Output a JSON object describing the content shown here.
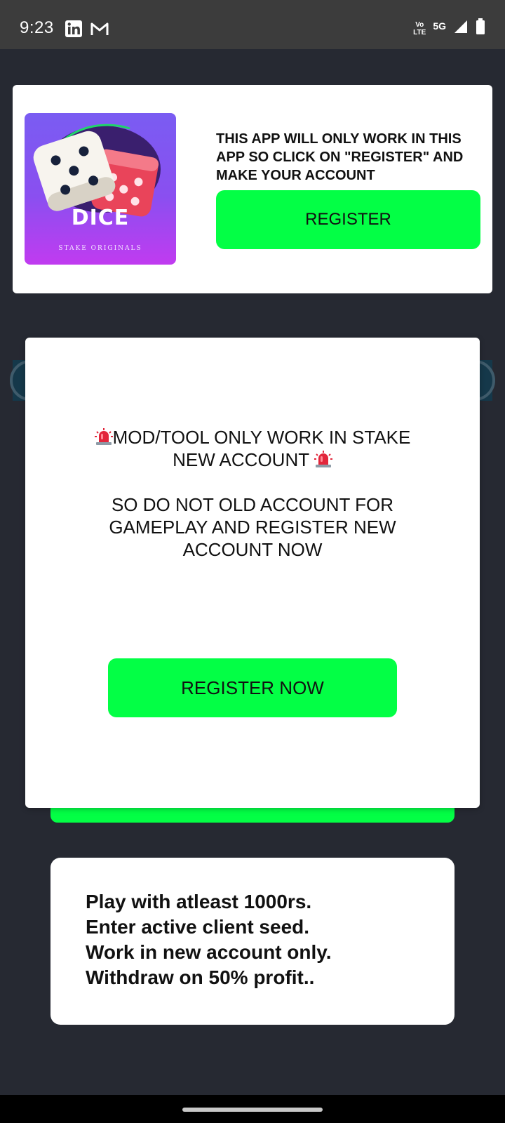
{
  "status_bar": {
    "time": "9:23",
    "left_icons": [
      "linkedin-icon",
      "gmail-icon"
    ],
    "volte_line1": "Vo",
    "volte_line2": "LTE",
    "network": "5G",
    "right_icons": [
      "volte-icon",
      "signal-icon",
      "battery-icon"
    ]
  },
  "top_card": {
    "logo_title": "DICE",
    "logo_subtitle": "STAKE ORIGINALS",
    "message": "THIS APP WILL ONLY WORK IN THIS APP SO CLICK ON \"REGISTER\" AND MAKE YOUR ACCOUNT",
    "register_label": "REGISTER"
  },
  "dialog": {
    "warning_line1": "MOD/TOOL ONLY WORK IN STAKE",
    "warning_line2": "NEW ACCOUNT",
    "instruction_line1": "SO DO NOT OLD ACCOUNT FOR",
    "instruction_line2": "GAMEPLAY AND REGISTER NEW",
    "instruction_line3": "ACCOUNT NOW",
    "register_now_label": "REGISTER NOW"
  },
  "info_card": {
    "lines": [
      "Play with atleast 1000rs.",
      "Enter active client seed.",
      "Work in new account only.",
      "Withdraw on 50% profit.."
    ]
  },
  "colors": {
    "accent_green": "#03ff45",
    "background": "#262932",
    "status_bar": "#3c3c3c"
  }
}
